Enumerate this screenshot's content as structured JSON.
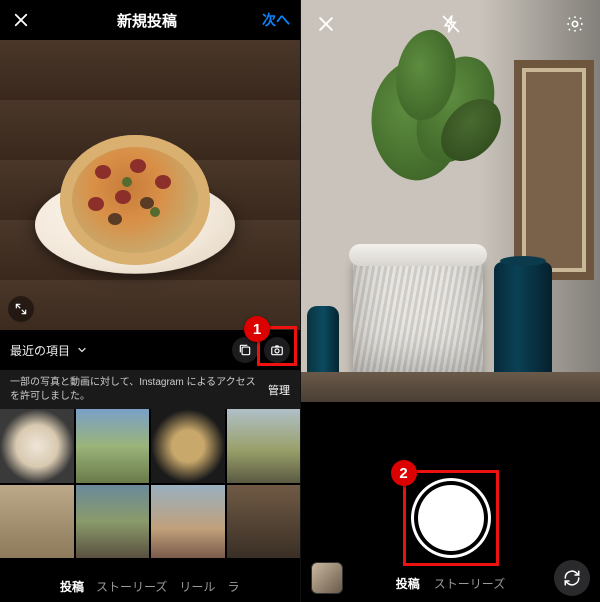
{
  "left": {
    "header": {
      "title": "新規投稿",
      "next": "次へ"
    },
    "album_label": "最近の項目",
    "permission": {
      "text": "一部の写真と動画に対して、Instagram によるアクセスを許可しました。",
      "manage": "管理"
    },
    "modes": {
      "post": "投稿",
      "stories": "ストーリーズ",
      "reels": "リール",
      "live": "ラ"
    },
    "icons": {
      "close": "close-icon",
      "expand": "expand-icon",
      "chevron": "chevron-down-icon",
      "multi": "multi-select-icon",
      "camera": "camera-icon"
    }
  },
  "right": {
    "top_icons": {
      "close": "close-icon",
      "flash": "flash-off-icon",
      "settings": "gear-icon"
    },
    "modes": {
      "post": "投稿",
      "stories": "ストーリーズ"
    },
    "bottom_icons": {
      "gallery": "gallery-thumb",
      "shutter": "shutter-button",
      "switch": "camera-switch-icon"
    }
  },
  "annotations": {
    "badge1": "1",
    "badge2": "2"
  }
}
